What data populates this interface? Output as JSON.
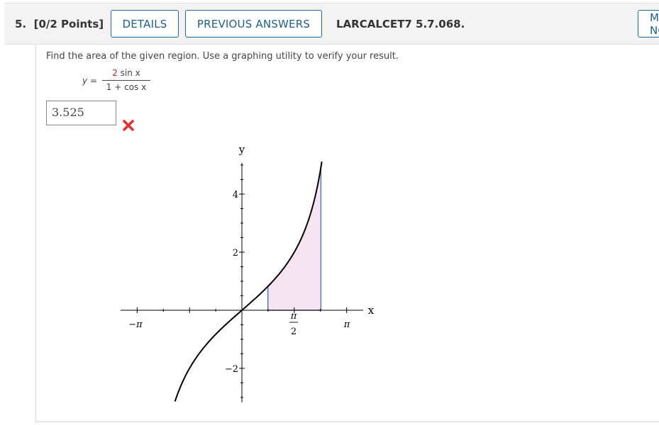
{
  "question": {
    "number_label": "5.",
    "points_label": "[0/2 Points]",
    "details_button": "DETAILS",
    "previous_answers_button": "PREVIOUS ANSWERS",
    "question_id": "LARCALCET7 5.7.068.",
    "more_button": "MY NOTES"
  },
  "problem": {
    "prompt": "Find the area of the given region. Use a graphing utility to verify your result.",
    "equation": {
      "lhs": "y =",
      "numerator_coef": "2",
      "numerator_rest": "sin x",
      "denominator": "1 + cos x"
    },
    "answer_value": "3.525",
    "answer_status": "incorrect",
    "status_icon": "red-x-icon"
  },
  "graph": {
    "x_axis_label": "x",
    "y_axis_label": "y",
    "x_tick_labels": [
      "−π",
      "π",
      "2",
      "π"
    ],
    "y_tick_labels": [
      "4",
      "2",
      "−2"
    ],
    "curve_color": "#000000",
    "region_fill": "#f7e4f1",
    "region_edge": "#4f6fbf"
  },
  "colors": {
    "accent": "#1d5f8a",
    "error": "#e03030",
    "coef_red": "#cc2222"
  }
}
